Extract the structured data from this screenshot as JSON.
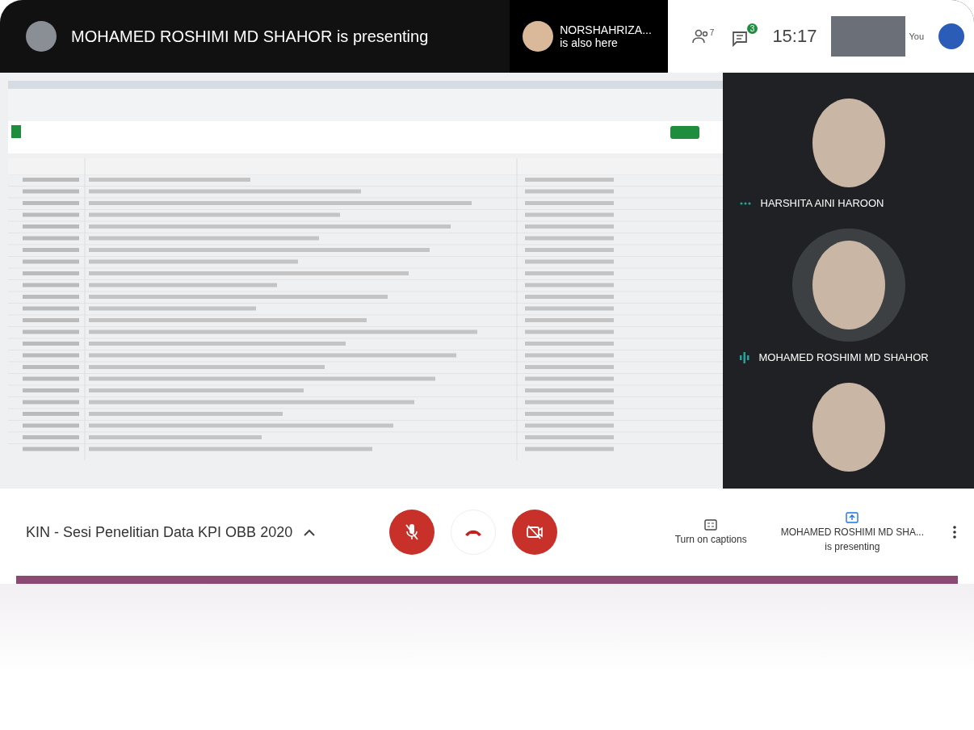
{
  "top_bar": {
    "presenter_notice": "MOHAMED ROSHIMI MD SHAHOR is presenting",
    "also_here": {
      "name": "NORSHAHRIZA...",
      "caption": "is also here"
    },
    "people_count": "7",
    "chat_badge": "3",
    "time": "15:17",
    "self_label": "You"
  },
  "participants": [
    {
      "kind": "named",
      "name": "HARSHITA AINI HAROON",
      "speaking": false
    },
    {
      "kind": "named",
      "name": "MOHAMED ROSHIMI MD SHAHOR",
      "speaking": true
    },
    {
      "kind": "avatar"
    }
  ],
  "bottom_bar": {
    "meeting_title": "KIN - Sesi Penelitian Data KPI OBB 2020",
    "controls": {
      "mic_muted": true,
      "camera_off": true
    },
    "captions_label": "Turn on captions",
    "presenting": {
      "name": "MOHAMED ROSHIMI MD SHA...",
      "caption": "is presenting"
    }
  }
}
